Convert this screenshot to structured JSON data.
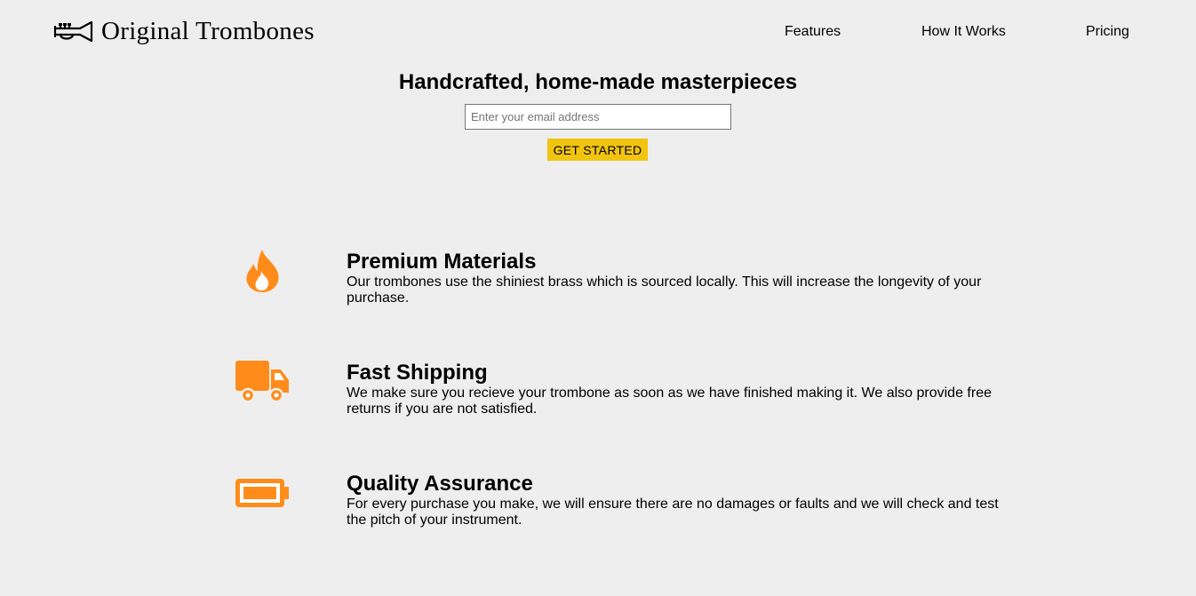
{
  "header": {
    "logo_text": "Original Trombones",
    "logo_icon": "trumpet-icon",
    "nav": [
      {
        "label": "Features"
      },
      {
        "label": "How It Works"
      },
      {
        "label": "Pricing"
      }
    ]
  },
  "hero": {
    "title": "Handcrafted, home-made masterpieces",
    "email_placeholder": "Enter your email address",
    "email_value": "",
    "cta_label": "GET STARTED"
  },
  "features": [
    {
      "icon": "fire-icon",
      "title": "Premium Materials",
      "description": "Our trombones use the shiniest brass which is sourced locally. This will increase the longevity of your purchase."
    },
    {
      "icon": "truck-icon",
      "title": "Fast Shipping",
      "description": "We make sure you recieve your trombone as soon as we have finished making it. We also provide free returns if you are not satisfied."
    },
    {
      "icon": "battery-icon",
      "title": "Quality Assurance",
      "description": "For every purchase you make, we will ensure there are no damages or faults and we will check and test the pitch of your instrument."
    }
  ],
  "colors": {
    "background": "#eeeeee",
    "accent_orange": "#ff8c1a",
    "cta_yellow": "#f1c40f"
  }
}
